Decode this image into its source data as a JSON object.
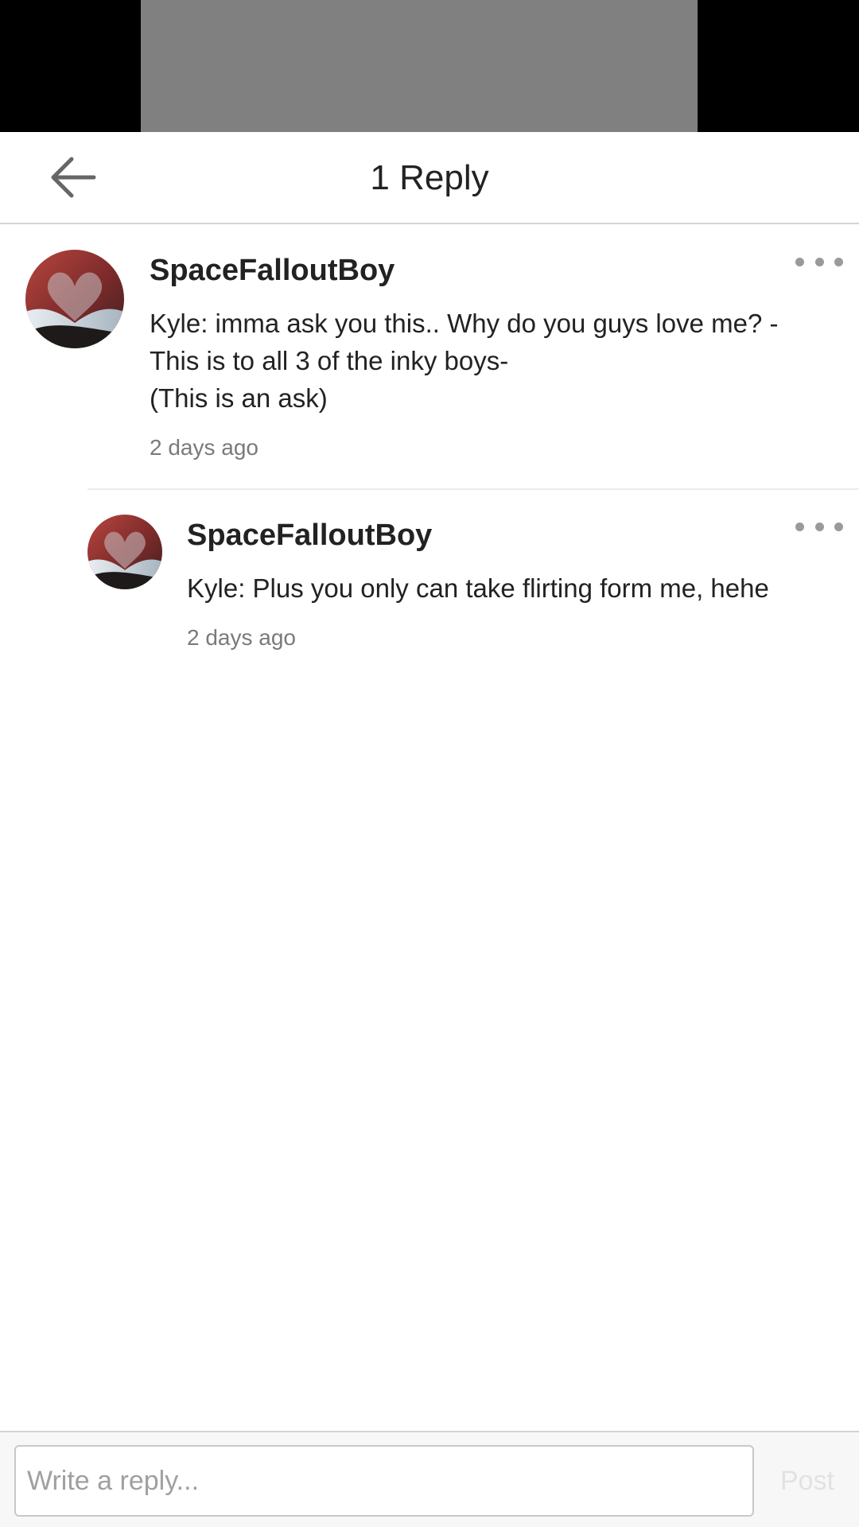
{
  "header": {
    "back_icon": "arrow-left-icon",
    "title": "1 Reply"
  },
  "comments": [
    {
      "author": "SpaceFalloutBoy",
      "body": "Kyle: imma ask you this.. Why do you guys love me? -\nThis is to all 3 of the inky boys-\n(This is an ask)",
      "time": "2 days ago",
      "menu_icon": "more-dots-icon"
    },
    {
      "author": "SpaceFalloutBoy",
      "body": "Kyle: Plus you only can take flirting form me, hehe",
      "time": "2 days ago",
      "menu_icon": "more-dots-icon"
    }
  ],
  "composer": {
    "placeholder": "Write a reply...",
    "post_label": "Post"
  },
  "colors": {
    "banner_bg": "#000000",
    "banner_media": "#808080",
    "text": "#222222",
    "muted_text": "#7a7a7a",
    "post_disabled": "#e2e2e2"
  }
}
